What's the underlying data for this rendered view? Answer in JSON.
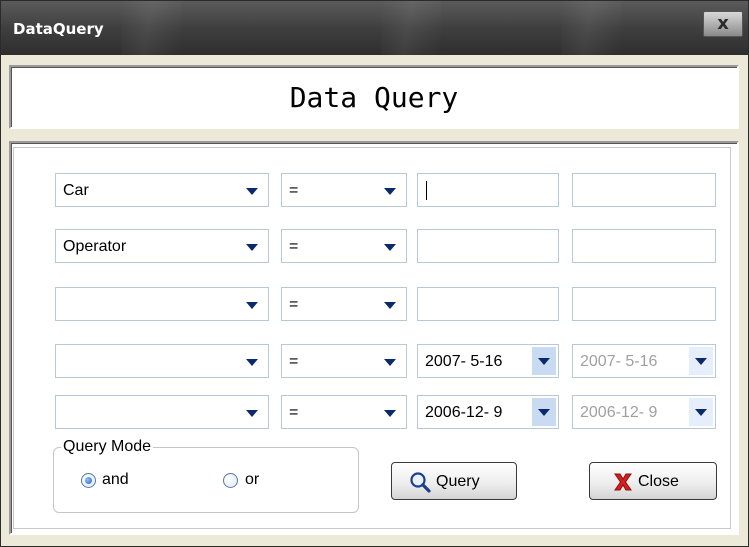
{
  "window": {
    "title": "DataQuery",
    "close_glyph": "x"
  },
  "header": {
    "title": "Data Query"
  },
  "rows": [
    {
      "field": "Car",
      "operator": "=",
      "value1": "",
      "value2": ""
    },
    {
      "field": "Operator",
      "operator": "=",
      "value1": "",
      "value2": ""
    },
    {
      "field": "",
      "operator": "=",
      "value1": "",
      "value2": ""
    },
    {
      "field": "",
      "operator": "=",
      "date1": "2007- 5-16",
      "date2": "2007- 5-16"
    },
    {
      "field": "",
      "operator": "=",
      "date1": "2006-12- 9",
      "date2": "2006-12- 9"
    }
  ],
  "query_mode": {
    "label": "Query Mode",
    "options": [
      {
        "label": "and",
        "selected": true
      },
      {
        "label": "or",
        "selected": false
      }
    ]
  },
  "buttons": {
    "query_label": "Query",
    "close_label": "Close",
    "query_icon": "magnifier-icon",
    "close_icon": "red-x-icon"
  },
  "colors": {
    "titlebar": "#3f3f3f",
    "accent_arrow": "#0a2a6a",
    "close_icon": "#d42020"
  }
}
